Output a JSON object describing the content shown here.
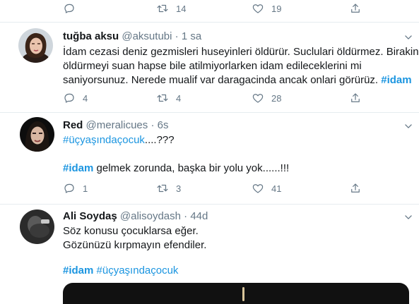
{
  "top_actions": {
    "reply": "",
    "retweet": "14",
    "like": "19"
  },
  "tweets": [
    {
      "name": "tuğba aksu",
      "handle": "@aksutubi",
      "sep": "·",
      "time": "1 sa",
      "lines": [
        "İdam cezasi deniz gezmisleri huseyinleri öldürür. Suclulari öldürmez. Birakin",
        "öldürmeyi suan hapse bile atilmiyorlarken idam edileceklerini mi",
        "saniyorsunuz.  Nerede mualif var daragacinda ancak onlari görürüz."
      ],
      "trailing_tag": "#idam",
      "actions": {
        "reply": "4",
        "retweet": "4",
        "like": "28"
      }
    },
    {
      "name": "Red",
      "handle": "@meralicues",
      "sep": "·",
      "time": "6s",
      "line1_tag": "#üçyaşındaçocuk",
      "line1_rest": "....???",
      "line2_tag": "#idam",
      "line2_rest": " gelmek zorunda, başka bir yolu yok......!!!",
      "actions": {
        "reply": "1",
        "retweet": "3",
        "like": "41"
      }
    },
    {
      "name": "Ali Soydaş",
      "handle": "@alisoydash",
      "sep": "·",
      "time": "44d",
      "lines": [
        "Söz konusu çocuklarsa eğer.",
        "Gözünüzü kırpmayın efendiler."
      ],
      "tag1": "#idam",
      "tag2": "#üçyaşındaçocuk"
    }
  ],
  "icons": {
    "reply": "reply-icon",
    "retweet": "retweet-icon",
    "like": "heart-icon",
    "share": "share-icon",
    "more": "chevron-down-icon"
  },
  "colors": {
    "accent": "#1b95e0",
    "muted": "#657786",
    "divider": "#e6ecf0"
  }
}
